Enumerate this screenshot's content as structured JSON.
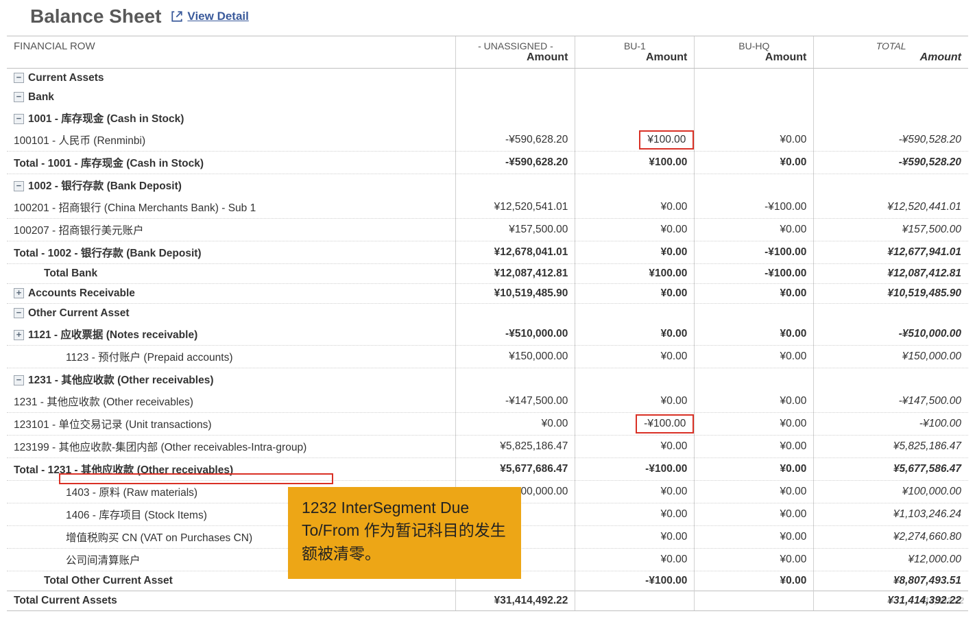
{
  "header": {
    "title": "Balance Sheet",
    "view_detail": "View Detail"
  },
  "columns": {
    "financial_row": "FINANCIAL ROW",
    "unassigned_top": "- UNASSIGNED -",
    "unassigned_bottom": "Amount",
    "bu1_top": "BU-1",
    "bu1_bottom": "Amount",
    "buhq_top": "BU-HQ",
    "buhq_bottom": "Amount",
    "total_top": "TOTAL",
    "total_bottom": "Amount"
  },
  "rows": {
    "current_assets": "Current Assets",
    "bank": "Bank",
    "acct_1001": "1001 - 库存现金 (Cash in Stock)",
    "acct_100101": "100101 - 人民币 (Renminbi)",
    "total_1001": "Total - 1001 - 库存现金 (Cash in Stock)",
    "acct_1002": "1002 - 银行存款 (Bank Deposit)",
    "acct_100201": "100201 - 招商银行 (China Merchants Bank) - Sub 1",
    "acct_100207": "100207 - 招商银行美元账户",
    "total_1002": "Total - 1002 - 银行存款 (Bank Deposit)",
    "total_bank": "Total Bank",
    "accounts_receivable": "Accounts Receivable",
    "other_current_asset": "Other Current Asset",
    "acct_1121": "1121 - 应收票据 (Notes receivable)",
    "acct_1123": "1123 - 预付账户 (Prepaid accounts)",
    "acct_1231": "1231 - 其他应收款 (Other receivables)",
    "acct_1231_sub": "1231 - 其他应收款 (Other receivables)",
    "acct_123101": "123101 - 单位交易记录 (Unit transactions)",
    "acct_123199": "123199 - 其他应收款-集团内部 (Other receivables-Intra-group)",
    "total_1231": "Total - 1231 - 其他应收款 (Other receivables)",
    "acct_1403": "1403 - 原料 (Raw materials)",
    "acct_1406": "1406 - 库存项目 (Stock Items)",
    "acct_vat": "增值税购买 CN (VAT on Purchases CN)",
    "acct_interco": "公司间清算账户",
    "total_other_current": "Total Other Current Asset",
    "total_current_assets": "Total Current Assets"
  },
  "values": {
    "r100101": {
      "u": "-¥590,628.20",
      "b1": "¥100.00",
      "hq": "¥0.00",
      "t": "-¥590,528.20"
    },
    "t1001": {
      "u": "-¥590,628.20",
      "b1": "¥100.00",
      "hq": "¥0.00",
      "t": "-¥590,528.20"
    },
    "r100201": {
      "u": "¥12,520,541.01",
      "b1": "¥0.00",
      "hq": "-¥100.00",
      "t": "¥12,520,441.01"
    },
    "r100207": {
      "u": "¥157,500.00",
      "b1": "¥0.00",
      "hq": "¥0.00",
      "t": "¥157,500.00"
    },
    "t1002": {
      "u": "¥12,678,041.01",
      "b1": "¥0.00",
      "hq": "-¥100.00",
      "t": "¥12,677,941.01"
    },
    "tbank": {
      "u": "¥12,087,412.81",
      "b1": "¥100.00",
      "hq": "-¥100.00",
      "t": "¥12,087,412.81"
    },
    "ar": {
      "u": "¥10,519,485.90",
      "b1": "¥0.00",
      "hq": "¥0.00",
      "t": "¥10,519,485.90"
    },
    "r1121": {
      "u": "-¥510,000.00",
      "b1": "¥0.00",
      "hq": "¥0.00",
      "t": "-¥510,000.00"
    },
    "r1123": {
      "u": "¥150,000.00",
      "b1": "¥0.00",
      "hq": "¥0.00",
      "t": "¥150,000.00"
    },
    "r1231s": {
      "u": "-¥147,500.00",
      "b1": "¥0.00",
      "hq": "¥0.00",
      "t": "-¥147,500.00"
    },
    "r123101": {
      "u": "¥0.00",
      "b1": "-¥100.00",
      "hq": "¥0.00",
      "t": "-¥100.00"
    },
    "r123199": {
      "u": "¥5,825,186.47",
      "b1": "¥0.00",
      "hq": "¥0.00",
      "t": "¥5,825,186.47"
    },
    "t1231": {
      "u": "¥5,677,686.47",
      "b1": "-¥100.00",
      "hq": "¥0.00",
      "t": "¥5,677,586.47"
    },
    "r1403": {
      "u": "¥100,000.00",
      "b1": "¥0.00",
      "hq": "¥0.00",
      "t": "¥100,000.00"
    },
    "r1406": {
      "u": "",
      "b1": "¥0.00",
      "hq": "¥0.00",
      "t": "¥1,103,246.24"
    },
    "rvat": {
      "u": "",
      "b1": "¥0.00",
      "hq": "¥0.00",
      "t": "¥2,274,660.80"
    },
    "rinterco": {
      "u": "",
      "b1": "¥0.00",
      "hq": "¥0.00",
      "t": "¥12,000.00"
    },
    "toca": {
      "u": "",
      "b1": "-¥100.00",
      "hq": "¥0.00",
      "t": "¥8,807,493.51"
    },
    "tca": {
      "u": "¥31,414,492.22",
      "b1": "",
      "hq": "",
      "t": "¥31,414,392.22"
    }
  },
  "note": "1232 InterSegment Due To/From 作为暂记科目的发生额被清零。",
  "watermark": "414,392.22"
}
